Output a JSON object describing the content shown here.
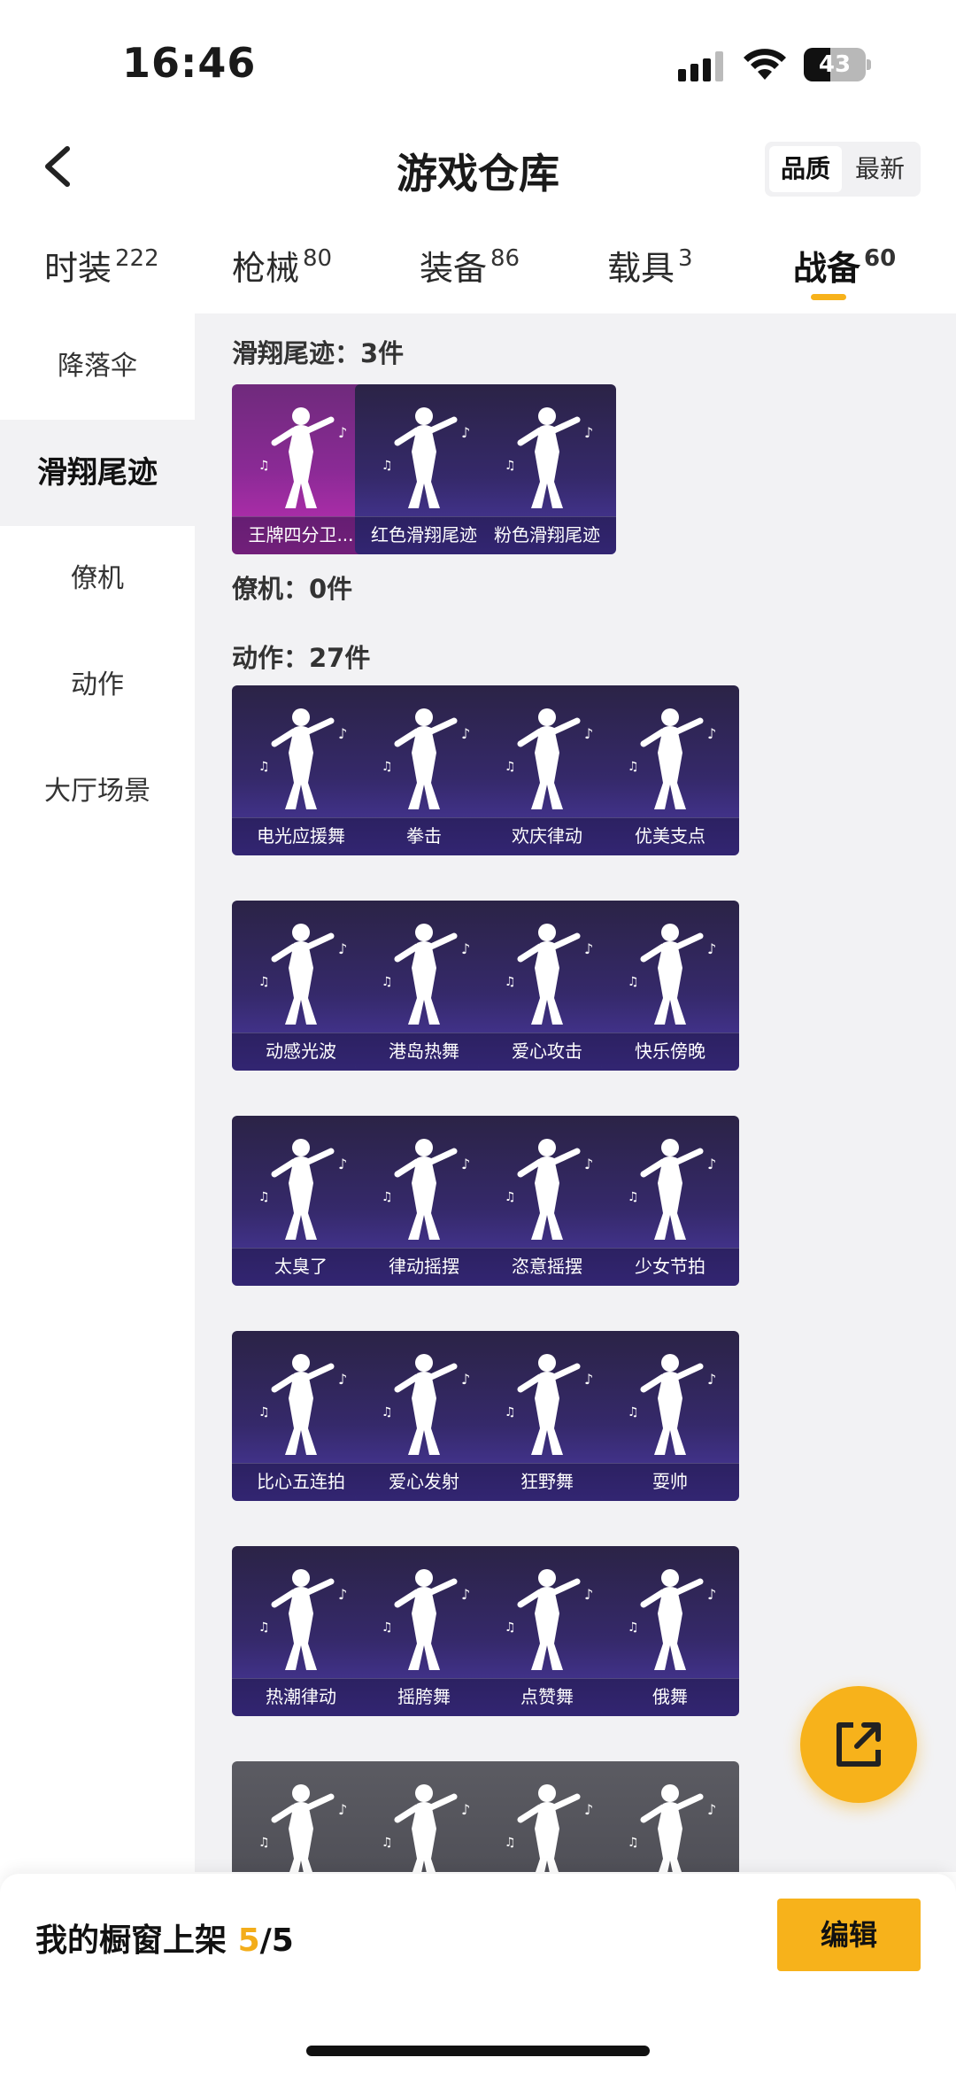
{
  "status_bar": {
    "time": "16:46",
    "battery": "43",
    "battery_level": 0.43
  },
  "header": {
    "title": "游戏仓库",
    "sort_options": [
      "品质",
      "最新"
    ],
    "sort_selected": "品质"
  },
  "tabs": [
    {
      "label": "时装",
      "count": "222"
    },
    {
      "label": "枪械",
      "count": "80"
    },
    {
      "label": "装备",
      "count": "86"
    },
    {
      "label": "载具",
      "count": "3"
    },
    {
      "label": "战备",
      "count": "60"
    }
  ],
  "active_tab": "战备",
  "sidebar": {
    "items": [
      "降落伞",
      "滑翔尾迹",
      "僚机",
      "动作",
      "大厅场景"
    ],
    "active": "滑翔尾迹"
  },
  "sections": {
    "glide": {
      "title": "滑翔尾迹：3件",
      "items": [
        "王牌四分卫...",
        "红色滑翔尾迹",
        "粉色滑翔尾迹"
      ]
    },
    "wingman": {
      "title": "僚机：0件"
    },
    "emotes": {
      "title": "动作：27件",
      "items": [
        "电光应援舞",
        "拳击",
        "欢庆律动",
        "优美支点",
        "动感光波",
        "港岛热舞",
        "爱心攻击",
        "快乐傍晚",
        "太臭了",
        "律动摇摆",
        "恣意摇摆",
        "少女节拍",
        "比心五连拍",
        "爱心发射",
        "狂野舞",
        "耍帅",
        "热潮律动",
        "摇胯舞",
        "点赞舞",
        "俄舞"
      ]
    }
  },
  "bottom_bar": {
    "label": "我的橱窗上架",
    "count_current": "5",
    "count_total": "/5",
    "edit_label": "编辑"
  },
  "colors": {
    "accent": "#f7b21b",
    "card_purple": "#35296a",
    "card_pink": "#8a2a95"
  },
  "icons": [
    "back-icon",
    "signal-icon",
    "wifi-icon",
    "battery-icon",
    "share-icon",
    "dancer-icon"
  ]
}
